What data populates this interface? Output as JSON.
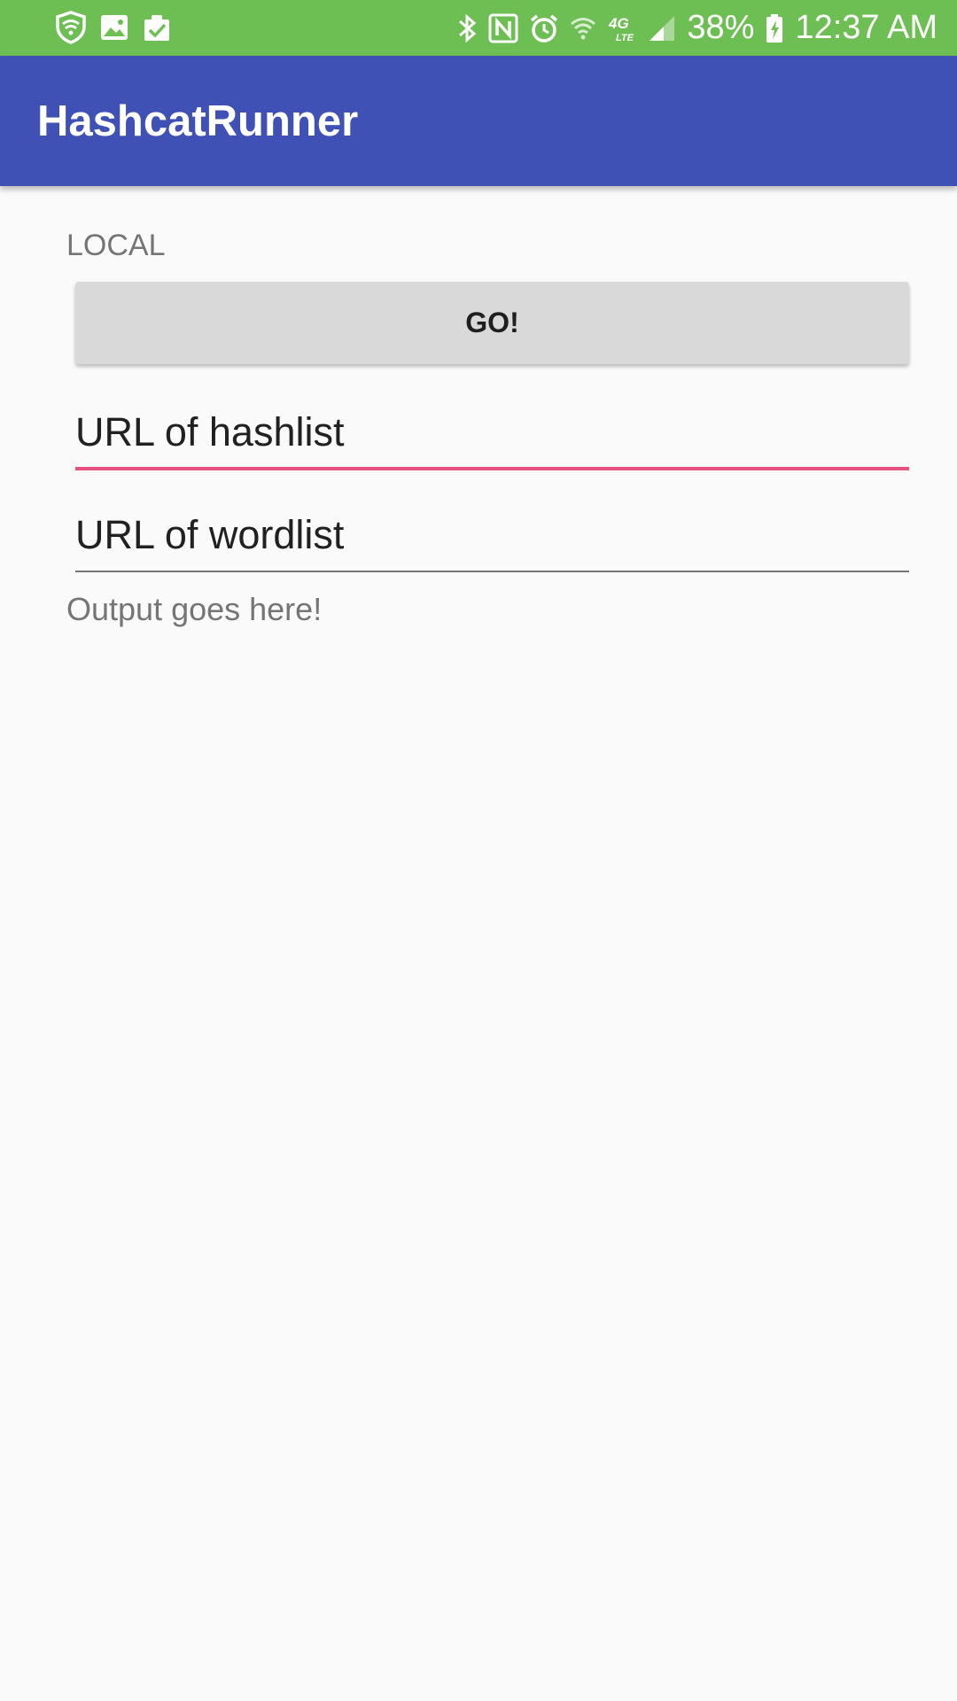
{
  "status_bar": {
    "left_icons": [
      "shield-wifi-icon",
      "gallery-icon",
      "clipboard-check-icon"
    ],
    "right_icons": [
      "bluetooth-icon",
      "nfc-icon",
      "alarm-icon",
      "wifi-icon",
      "lte-4g-icon",
      "signal-icon"
    ],
    "battery_percent": "38%",
    "time": "12:37 AM",
    "background_color": "#6dbe53"
  },
  "app_bar": {
    "title": "HashcatRunner",
    "background_color": "#3f51b5"
  },
  "main": {
    "section_label": "LOCAL",
    "go_button_label": "GO!",
    "hashlist_field": {
      "placeholder": "URL of hashlist",
      "value": "",
      "focused": true,
      "accent_color": "#e6527f"
    },
    "wordlist_field": {
      "placeholder": "URL of wordlist",
      "value": ""
    },
    "output_text": "Output goes here!"
  }
}
